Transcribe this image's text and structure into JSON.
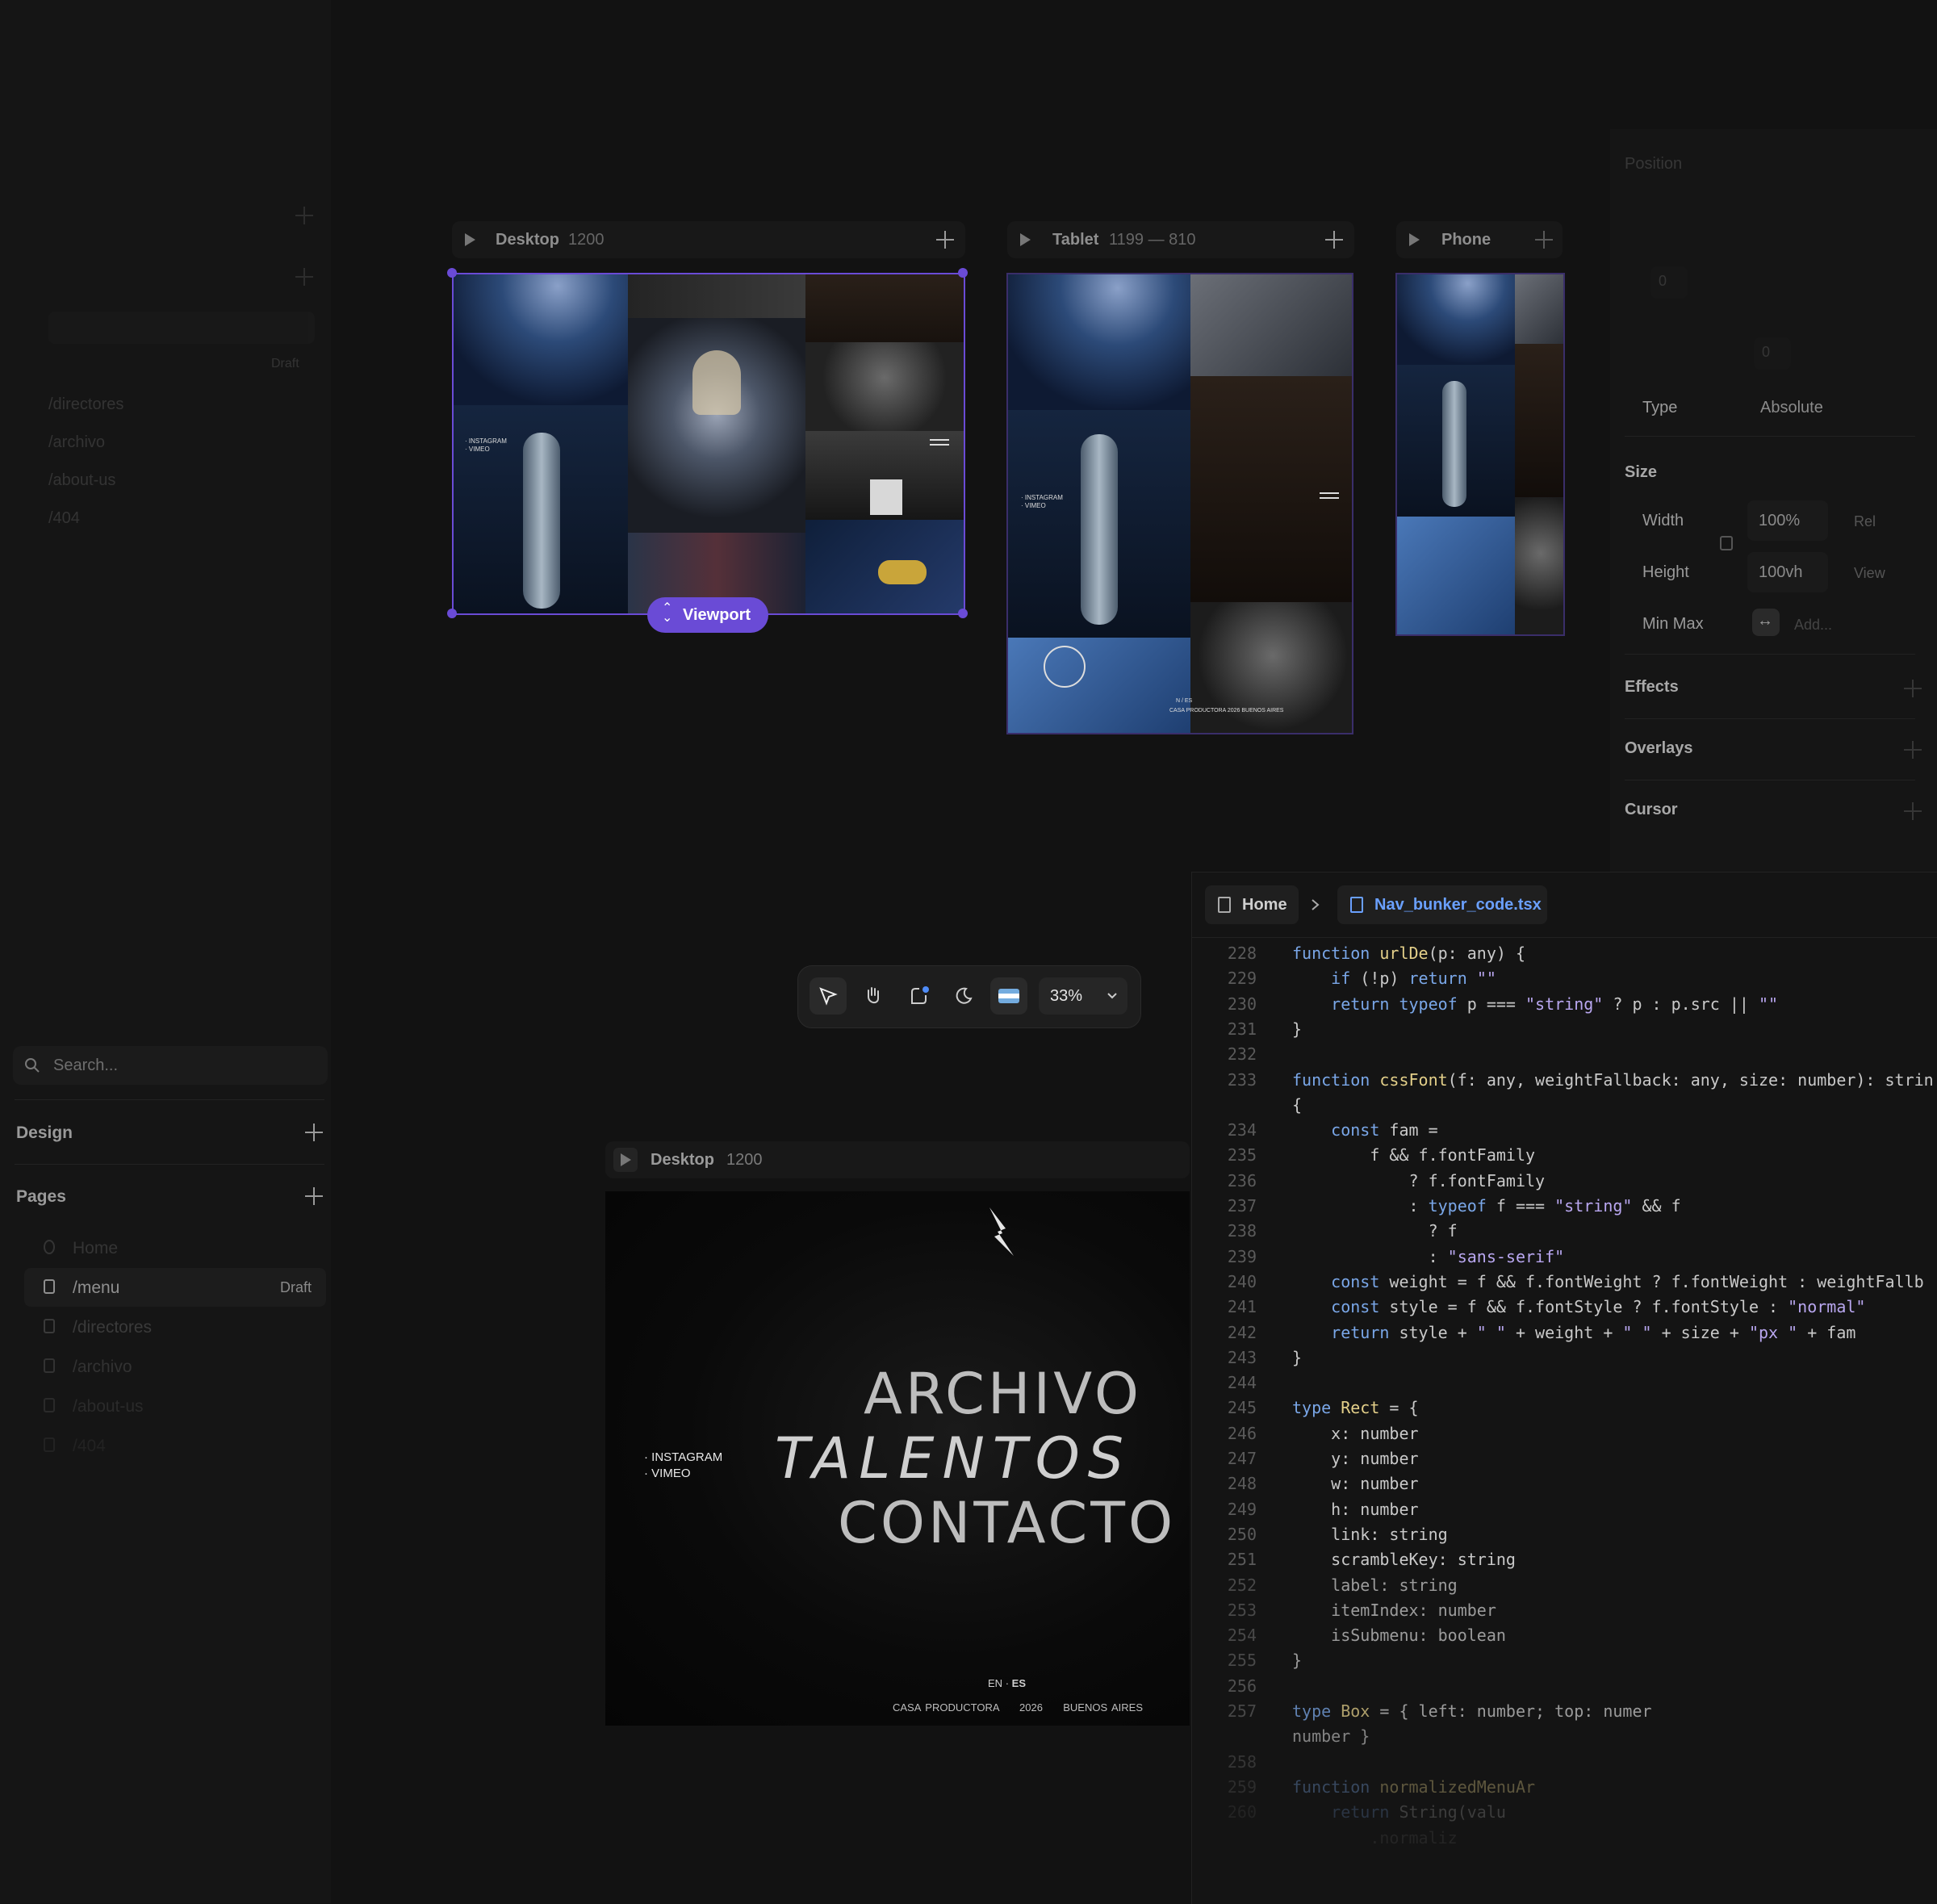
{
  "left_panel": {
    "faded_rows": [
      "/directores",
      "/archivo",
      "/about-us",
      "/404"
    ],
    "faded_draft": "Draft",
    "search_placeholder": "Search...",
    "design_title": "Design",
    "pages_title": "Pages",
    "pages": [
      {
        "label": "Home",
        "badge": ""
      },
      {
        "label": "/menu",
        "badge": "Draft"
      },
      {
        "label": "/directores",
        "badge": ""
      },
      {
        "label": "/archivo",
        "badge": ""
      },
      {
        "label": "/about-us",
        "badge": ""
      },
      {
        "label": "/404",
        "badge": ""
      }
    ]
  },
  "canvas": {
    "frames": [
      {
        "name": "Desktop",
        "dim": "1200"
      },
      {
        "name": "Tablet",
        "dim": "1199 — 810"
      },
      {
        "name": "Phone",
        "dim": ""
      }
    ],
    "viewport_label": "Viewport",
    "mini_links": "· INSTAGRAM\n· VIMEO",
    "mini_footer": "CASA PRODUCTORA 2026 BUENOS AIRES",
    "lang_mini": "N / ES"
  },
  "toolbar": {
    "zoom": "33%",
    "tools": [
      "pointer-tool",
      "hand-tool",
      "comment-tool",
      "theme-toggle",
      "locale-flag"
    ]
  },
  "properties": {
    "position_title": "Position",
    "position_values": [
      "0",
      "0"
    ],
    "type_label": "Type",
    "type_value": "Absolute",
    "size_title": "Size",
    "width_label": "Width",
    "width_value": "100%",
    "width_unit": "Rel",
    "height_label": "Height",
    "height_value": "100vh",
    "height_unit": "View",
    "minmax_label": "Min Max",
    "minmax_value": "Add...",
    "sections": [
      "Effects",
      "Overlays",
      "Cursor"
    ]
  },
  "editor": {
    "breadcrumb_home": "Home",
    "breadcrumb_file": "Nav_bunker_code.tsx",
    "lines": [
      {
        "n": "228",
        "t": "function urlDe(p: any) {"
      },
      {
        "n": "229",
        "t": "    if (!p) return \"\""
      },
      {
        "n": "230",
        "t": "    return typeof p === \"string\" ? p : p.src || \"\""
      },
      {
        "n": "231",
        "t": "}"
      },
      {
        "n": "232",
        "t": ""
      },
      {
        "n": "233",
        "t": "function cssFont(f: any, weightFallback: any, size: number): strin"
      },
      {
        "n": "",
        "t": "{"
      },
      {
        "n": "234",
        "t": "    const fam ="
      },
      {
        "n": "235",
        "t": "        f && f.fontFamily"
      },
      {
        "n": "236",
        "t": "            ? f.fontFamily"
      },
      {
        "n": "237",
        "t": "            : typeof f === \"string\" && f"
      },
      {
        "n": "238",
        "t": "              ? f"
      },
      {
        "n": "239",
        "t": "              : \"sans-serif\""
      },
      {
        "n": "240",
        "t": "    const weight = f && f.fontWeight ? f.fontWeight : weightFallb"
      },
      {
        "n": "241",
        "t": "    const style = f && f.fontStyle ? f.fontStyle : \"normal\""
      },
      {
        "n": "242",
        "t": "    return style + \" \" + weight + \" \" + size + \"px \" + fam"
      },
      {
        "n": "243",
        "t": "}"
      },
      {
        "n": "244",
        "t": ""
      },
      {
        "n": "245",
        "t": "type Rect = {"
      },
      {
        "n": "246",
        "t": "    x: number"
      },
      {
        "n": "247",
        "t": "    y: number"
      },
      {
        "n": "248",
        "t": "    w: number"
      },
      {
        "n": "249",
        "t": "    h: number"
      },
      {
        "n": "250",
        "t": "    link: string"
      },
      {
        "n": "251",
        "t": "    scrambleKey: string"
      },
      {
        "n": "252",
        "t": "    label: string"
      },
      {
        "n": "253",
        "t": "    itemIndex: number"
      },
      {
        "n": "254",
        "t": "    isSubmenu: boolean"
      },
      {
        "n": "255",
        "t": "}"
      },
      {
        "n": "256",
        "t": ""
      },
      {
        "n": "257",
        "t": "type Box = { left: number; top: numer"
      },
      {
        "n": "",
        "t": "number }"
      },
      {
        "n": "258",
        "t": ""
      },
      {
        "n": "259",
        "t": "function normalizedMenuAr"
      },
      {
        "n": "260",
        "t": "    return String(valu"
      },
      {
        "n": "",
        "t": "        .normaliz"
      }
    ]
  },
  "preview": {
    "name": "Desktop",
    "dim": "1200",
    "links": [
      "· INSTAGRAM",
      "· VIMEO"
    ],
    "menu": [
      "ARCHIVO",
      "TALENTOS",
      "CONTACTO"
    ],
    "lang_en": "EN",
    "lang_dot": "·",
    "lang_es": "ES",
    "footer": [
      "CASA PRODUCTORA",
      "2026",
      "BUENOS AIRES"
    ]
  },
  "colors": {
    "accent": "#6a4bd6",
    "background": "#121212",
    "file_blue": "#6aa0ff"
  }
}
